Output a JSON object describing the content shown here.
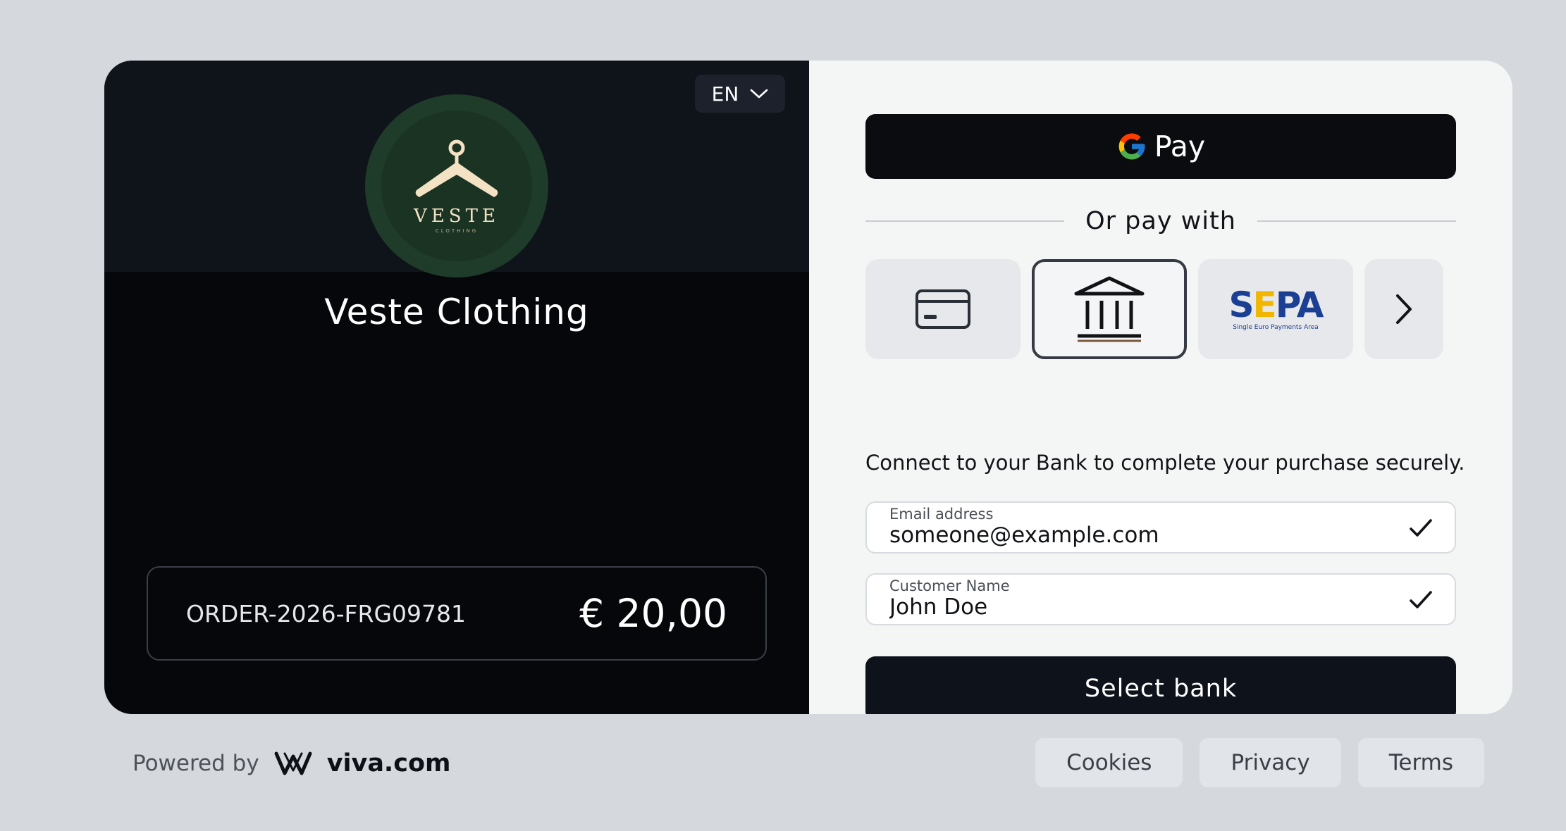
{
  "language": {
    "selected": "EN"
  },
  "merchant": {
    "name": "Veste Clothing",
    "logo_word": "VESTE",
    "logo_sub": "CLOTHING",
    "logo_colors": {
      "outer": "#1f3b29",
      "hanger": "#f3e2c3"
    }
  },
  "order": {
    "id": "ORDER-2026-FRG09781",
    "amount": "€ 20,00"
  },
  "payment": {
    "gpay_label": "Pay",
    "divider_text": "Or pay with",
    "methods": [
      {
        "name": "card",
        "icon": "credit-card-icon",
        "selected": false
      },
      {
        "name": "bank",
        "icon": "bank-icon",
        "selected": true
      },
      {
        "name": "sepa",
        "icon": "sepa-logo",
        "selected": false
      },
      {
        "name": "more",
        "icon": "chevron-right-icon",
        "selected": false
      }
    ],
    "sepa_logo": {
      "text": "SEPA",
      "sub": "Single Euro Payments Area"
    },
    "connect_text": "Connect to your Bank to complete your purchase securely.",
    "email": {
      "label": "Email address",
      "value": "someone@example.com"
    },
    "customer_name": {
      "label": "Customer Name",
      "value": "John Doe"
    },
    "submit_label": "Select bank"
  },
  "footer": {
    "powered_by": "Powered by",
    "brand": "viva.com",
    "links": [
      "Cookies",
      "Privacy",
      "Terms"
    ]
  },
  "colors": {
    "page_bg": "#d5d8dd",
    "left_panel": "#06070a",
    "right_panel": "#f4f6f6",
    "primary_button": "#0e131b"
  }
}
